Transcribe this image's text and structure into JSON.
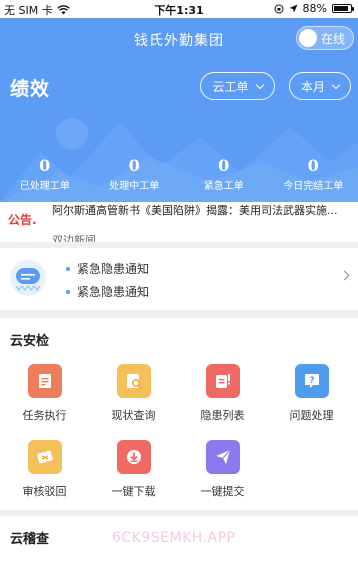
{
  "status_bar": {
    "carrier": "无 SIM 卡",
    "time": "下午1:31",
    "battery": "88%",
    "battery_level": 0.88
  },
  "header": {
    "title": "钱氏外勤集团",
    "toggle_label": "在线",
    "section_title": "绩效",
    "filter_type": "云工单",
    "filter_period": "本月"
  },
  "stats": [
    {
      "value": "0",
      "label": "已处理工单"
    },
    {
      "value": "0",
      "label": "处理中工单"
    },
    {
      "value": "0",
      "label": "紧急工单"
    },
    {
      "value": "0",
      "label": "今日完结工单"
    }
  ],
  "announcement": {
    "tag": "公告.",
    "line1": "阿尔斯通高管新书《美国陷阱》揭露：美用司法武器实施...",
    "line2": "双边新闻"
  },
  "notice": {
    "items": [
      "紧急隐患通知",
      "紧急隐患通知"
    ]
  },
  "cloud_inspection": {
    "title": "云安检",
    "items": [
      {
        "label": "任务执行",
        "icon": "task-icon",
        "color": "#ee7d5c"
      },
      {
        "label": "现状查询",
        "icon": "query-icon",
        "color": "#f4c05a"
      },
      {
        "label": "隐患列表",
        "icon": "hazard-list-icon",
        "color": "#ee6a62"
      },
      {
        "label": "问题处理",
        "icon": "question-icon",
        "color": "#4f9bee"
      },
      {
        "label": "审核驳回",
        "icon": "reject-icon",
        "color": "#f4c05a"
      },
      {
        "label": "一键下载",
        "icon": "download-icon",
        "color": "#ee6a62"
      },
      {
        "label": "一键提交",
        "icon": "submit-icon",
        "color": "#8d79ee"
      }
    ]
  },
  "cloud_audit": {
    "title": "云稽查",
    "watermark": "6CK9SEMKH.APP"
  },
  "colors": {
    "primary": "#5d9cf5",
    "alert": "#e23c3c"
  }
}
